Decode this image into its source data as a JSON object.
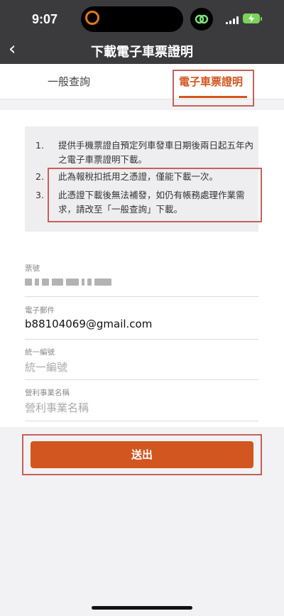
{
  "status_bar": {
    "time": "9:07"
  },
  "header": {
    "back_icon": "chevron-left-icon",
    "title": "下載電子車票證明"
  },
  "tabs": [
    {
      "label": "一般查詢",
      "active": false
    },
    {
      "label": "電子車票證明",
      "active": true
    }
  ],
  "notice": {
    "items": [
      {
        "num": "1.",
        "text": "提供手機票證自預定列車發車日期後兩日起五年內之電子車票證明下載。"
      },
      {
        "num": "2.",
        "text": "此為報稅扣抵用之憑證，僅能下載一次。"
      },
      {
        "num": "3.",
        "text": "此憑證下載後無法補發，如仍有帳務處理作業需求，請改至「一般查詢」下載。"
      }
    ]
  },
  "form": {
    "ticket_label": "票號",
    "email_label": "電子郵件",
    "email_value": "b88104069@gmail.com",
    "tax_id_label": "統一編號",
    "tax_id_placeholder": "統一編號",
    "company_label": "營利事業名稱",
    "company_placeholder": "營利事業名稱"
  },
  "submit_label": "送出",
  "colors": {
    "accent": "#d2561f",
    "header_bg": "#3b3b3d",
    "highlight_box": "#c6605a"
  }
}
